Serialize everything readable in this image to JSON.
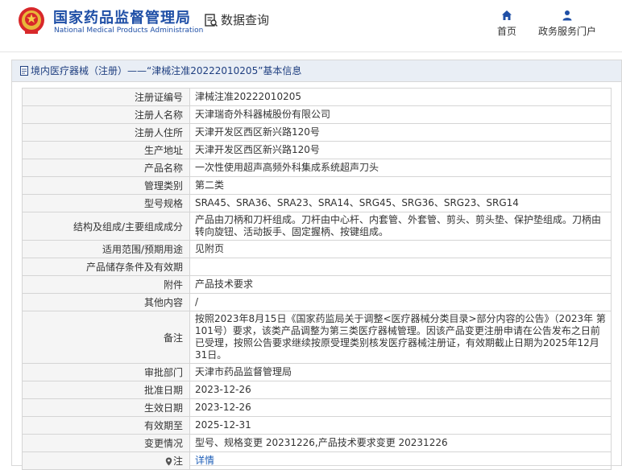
{
  "header": {
    "logo_cn": "国家药品监督管理局",
    "logo_en": "National Medical Products Administration",
    "query_label": "数据查询",
    "nav_home": "首页",
    "nav_portal": "政务服务门户"
  },
  "panel": {
    "breadcrumb": "境内医疗器械（注册）——“津械注准20222010205”基本信息"
  },
  "rows": [
    {
      "label": "注册证编号",
      "value": "津械注准20222010205"
    },
    {
      "label": "注册人名称",
      "value": "天津瑞奇外科器械股份有限公司"
    },
    {
      "label": "注册人住所",
      "value": "天津开发区西区新兴路120号"
    },
    {
      "label": "生产地址",
      "value": "天津开发区西区新兴路120号"
    },
    {
      "label": "产品名称",
      "value": "一次性使用超声高频外科集成系统超声刀头"
    },
    {
      "label": "管理类别",
      "value": "第二类"
    },
    {
      "label": "型号规格",
      "value": "SRA45、SRA36、SRA23、SRA14、SRG45、SRG36、SRG23、SRG14"
    },
    {
      "label": "结构及组成/主要组成成分",
      "value": "产品由刀柄和刀杆组成。刀杆由中心杆、内套管、外套管、剪头、剪头垫、保护垫组成。刀柄由转向旋钮、活动扳手、固定握柄、按键组成。"
    },
    {
      "label": "适用范围/预期用途",
      "value": "见附页"
    },
    {
      "label": "产品储存条件及有效期",
      "value": ""
    },
    {
      "label": "附件",
      "value": "产品技术要求"
    },
    {
      "label": "其他内容",
      "value": "/"
    },
    {
      "label": "备注",
      "value": "按照2023年8月15日《国家药监局关于调整<医疗器械分类目录>部分内容的公告》（2023年 第101号）要求，该类产品调整为第三类医疗器械管理。因该产品变更注册申请在公告发布之日前已受理，按照公告要求继续按原受理类别核发医疗器械注册证，有效期截止日期为2025年12月31日。"
    },
    {
      "label": "审批部门",
      "value": "天津市药品监督管理局"
    },
    {
      "label": "批准日期",
      "value": "2023-12-26"
    },
    {
      "label": "生效日期",
      "value": "2023-12-26"
    },
    {
      "label": "有效期至",
      "value": "2025-12-31"
    },
    {
      "label": "变更情况",
      "value": "型号、规格变更 20231226,产品技术要求变更 20231226"
    }
  ],
  "note_row": {
    "label": "注",
    "link": "详情"
  },
  "colors": {
    "brand_blue": "#1f4fa6",
    "link_blue": "#1f5fb8",
    "title_bar": "#e9eef5"
  }
}
